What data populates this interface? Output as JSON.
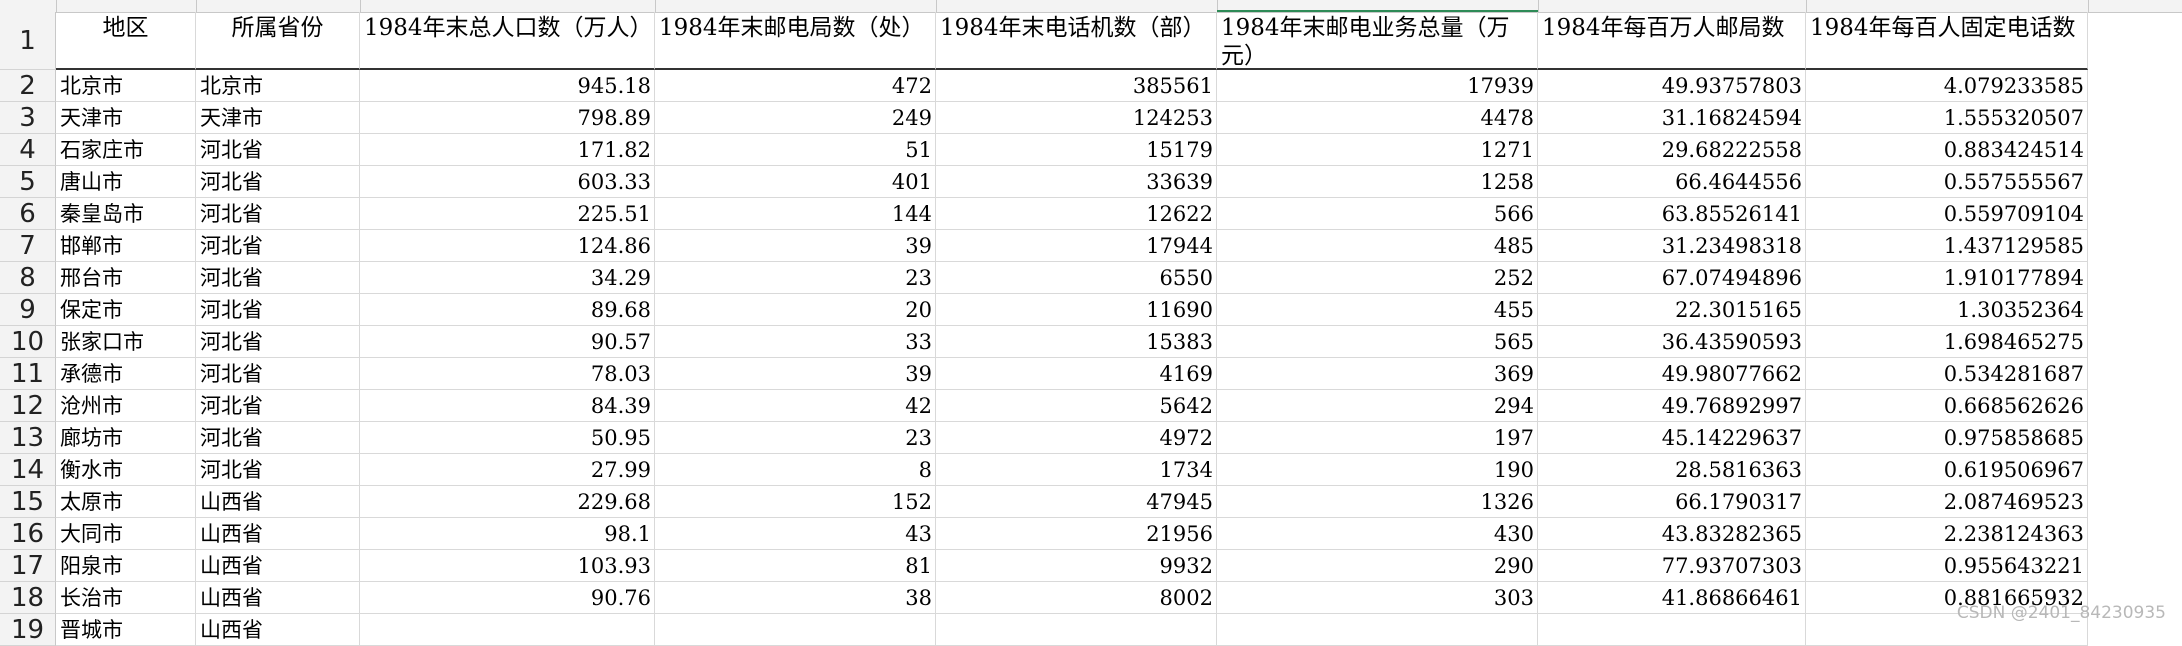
{
  "sheet": {
    "headers": [
      "地区",
      "所属省份",
      "1984年末总人口数（万人）",
      "1984年末邮电局数（处）",
      "1984年末电话机数（部）",
      "1984年末邮电业务总量（万元）",
      "1984年每百万人邮局数",
      "1984年每百人固定电话数"
    ],
    "rows": [
      {
        "num": "2",
        "cells": [
          "北京市",
          "北京市",
          "945.18",
          "472",
          "385561",
          "17939",
          "49.93757803",
          "4.079233585"
        ]
      },
      {
        "num": "3",
        "cells": [
          "天津市",
          "天津市",
          "798.89",
          "249",
          "124253",
          "4478",
          "31.16824594",
          "1.555320507"
        ]
      },
      {
        "num": "4",
        "cells": [
          "石家庄市",
          "河北省",
          "171.82",
          "51",
          "15179",
          "1271",
          "29.68222558",
          "0.883424514"
        ]
      },
      {
        "num": "5",
        "cells": [
          "唐山市",
          "河北省",
          "603.33",
          "401",
          "33639",
          "1258",
          "66.4644556",
          "0.557555567"
        ]
      },
      {
        "num": "6",
        "cells": [
          "秦皇岛市",
          "河北省",
          "225.51",
          "144",
          "12622",
          "566",
          "63.85526141",
          "0.559709104"
        ]
      },
      {
        "num": "7",
        "cells": [
          "邯郸市",
          "河北省",
          "124.86",
          "39",
          "17944",
          "485",
          "31.23498318",
          "1.437129585"
        ]
      },
      {
        "num": "8",
        "cells": [
          "邢台市",
          "河北省",
          "34.29",
          "23",
          "6550",
          "252",
          "67.07494896",
          "1.910177894"
        ]
      },
      {
        "num": "9",
        "cells": [
          "保定市",
          "河北省",
          "89.68",
          "20",
          "11690",
          "455",
          "22.3015165",
          "1.30352364"
        ]
      },
      {
        "num": "10",
        "cells": [
          "张家口市",
          "河北省",
          "90.57",
          "33",
          "15383",
          "565",
          "36.43590593",
          "1.698465275"
        ]
      },
      {
        "num": "11",
        "cells": [
          "承德市",
          "河北省",
          "78.03",
          "39",
          "4169",
          "369",
          "49.98077662",
          "0.534281687"
        ]
      },
      {
        "num": "12",
        "cells": [
          "沧州市",
          "河北省",
          "84.39",
          "42",
          "5642",
          "294",
          "49.76892997",
          "0.668562626"
        ]
      },
      {
        "num": "13",
        "cells": [
          "廊坊市",
          "河北省",
          "50.95",
          "23",
          "4972",
          "197",
          "45.14229637",
          "0.975858685"
        ]
      },
      {
        "num": "14",
        "cells": [
          "衡水市",
          "河北省",
          "27.99",
          "8",
          "1734",
          "190",
          "28.5816363",
          "0.619506967"
        ]
      },
      {
        "num": "15",
        "cells": [
          "太原市",
          "山西省",
          "229.68",
          "152",
          "47945",
          "1326",
          "66.1790317",
          "2.087469523"
        ]
      },
      {
        "num": "16",
        "cells": [
          "大同市",
          "山西省",
          "98.1",
          "43",
          "21956",
          "430",
          "43.83282365",
          "2.238124363"
        ]
      },
      {
        "num": "17",
        "cells": [
          "阳泉市",
          "山西省",
          "103.93",
          "81",
          "9932",
          "290",
          "77.93707303",
          "0.955643221"
        ]
      },
      {
        "num": "18",
        "cells": [
          "长治市",
          "山西省",
          "90.76",
          "38",
          "8002",
          "303",
          "41.86866461",
          "0.881665932"
        ]
      },
      {
        "num": "19",
        "cells": [
          "晋城市",
          "山西省",
          "",
          "",
          "",
          "",
          "",
          ""
        ]
      }
    ]
  },
  "header_row_num": "1",
  "watermark": "CSDN @2401_84230935",
  "colors": {
    "selected_column_accent": "#2e8b57",
    "gridline": "#d9d9d9",
    "header_bg": "#f3f3f3"
  }
}
